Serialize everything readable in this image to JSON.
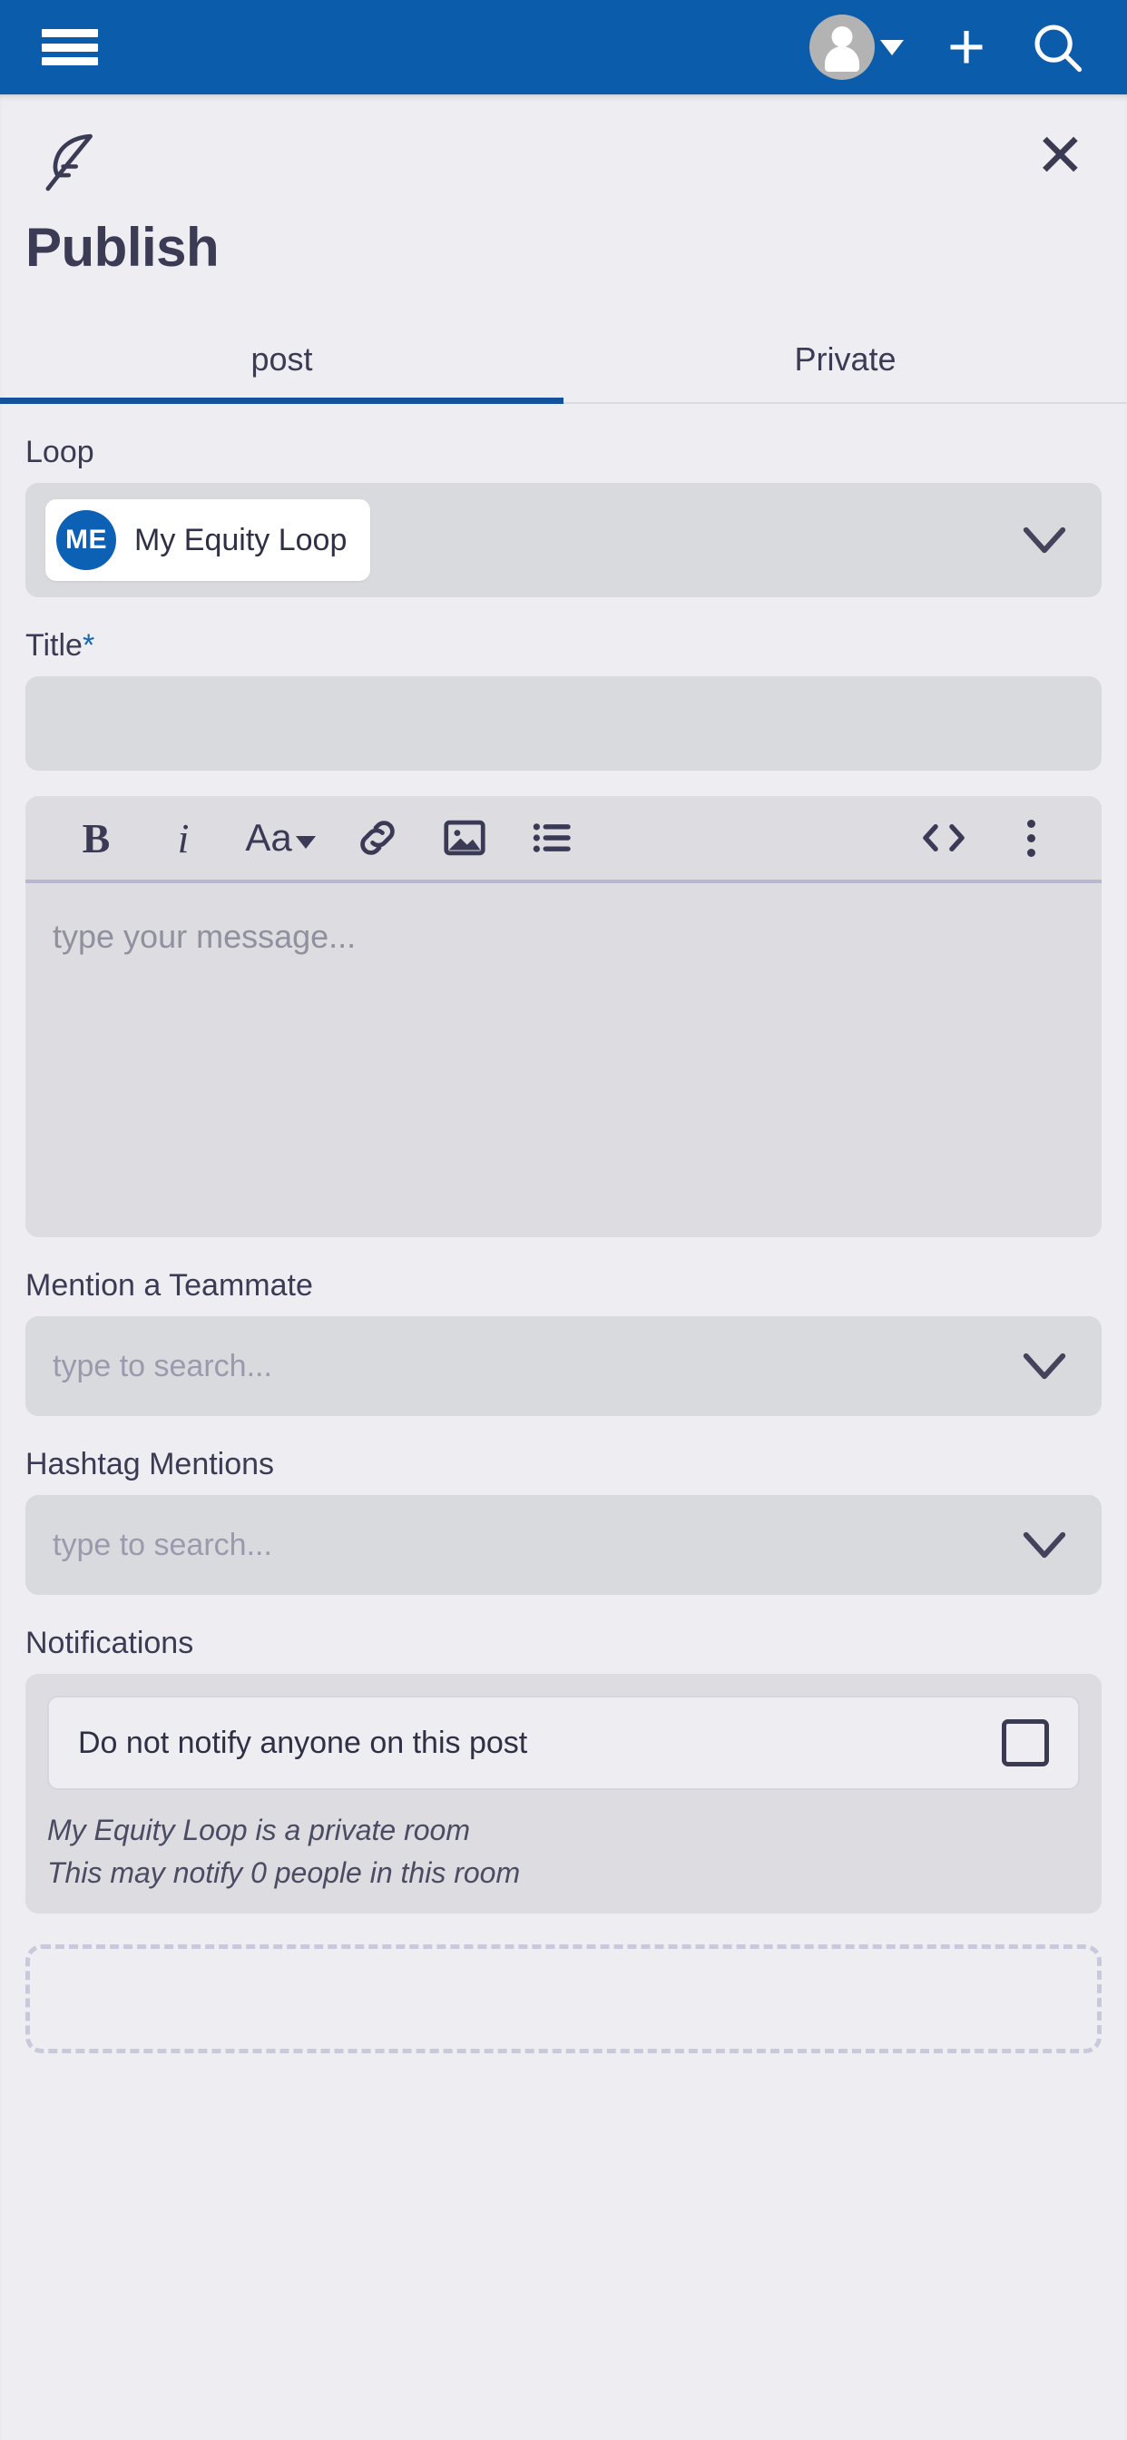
{
  "appbar": {
    "menu_icon": "hamburger-menu-icon",
    "avatar_icon": "user-avatar-icon",
    "avatar_caret_icon": "caret-down-icon",
    "add_label": "+",
    "add_icon": "plus-icon",
    "search_icon": "search-icon",
    "background": "#0b5cab"
  },
  "sheet": {
    "brand_icon": "feather-quill-icon",
    "close_label": "✕",
    "close_icon": "close-icon",
    "title": "Publish"
  },
  "tabs": [
    {
      "label": "post",
      "active": true
    },
    {
      "label": "Private",
      "active": false
    }
  ],
  "form": {
    "loop": {
      "label": "Loop",
      "selected_initials": "ME",
      "selected_value": "My Equity Loop",
      "chevron_icon": "chevron-down-icon",
      "avatar_color": "#0d61b5"
    },
    "title": {
      "label": "Title",
      "required_marker": "*",
      "value": "",
      "placeholder": ""
    },
    "editor": {
      "toolbar": [
        {
          "name": "bold-icon",
          "label": "B"
        },
        {
          "name": "italic-icon",
          "label": "i"
        },
        {
          "name": "font-size-icon",
          "label": "Aa"
        },
        {
          "name": "link-icon",
          "label": ""
        },
        {
          "name": "image-icon",
          "label": ""
        },
        {
          "name": "bulleted-list-icon",
          "label": ""
        },
        {
          "name": "code-icon",
          "label": "<>"
        },
        {
          "name": "more-options-icon",
          "label": ""
        }
      ],
      "placeholder": "type your message...",
      "value": ""
    },
    "mention_teammate": {
      "label": "Mention a Teammate",
      "placeholder": "type to search...",
      "value": "",
      "chevron_icon": "chevron-down-icon"
    },
    "hashtag_mentions": {
      "label": "Hashtag Mentions",
      "placeholder": "type to search...",
      "value": "",
      "chevron_icon": "chevron-down-icon"
    },
    "notifications": {
      "label": "Notifications",
      "option_label": "Do not notify anyone on this post",
      "checked": false,
      "note_line_1": "My Equity Loop is a private room",
      "note_line_2": "This may notify 0 people in this room"
    }
  },
  "colors": {
    "brand_blue": "#0b5cab",
    "tab_underline": "#14529c",
    "page_bg": "#eeeef2",
    "control_bg": "#d9dade",
    "text_dark": "#3b3b55",
    "placeholder": "#9a9aae"
  }
}
